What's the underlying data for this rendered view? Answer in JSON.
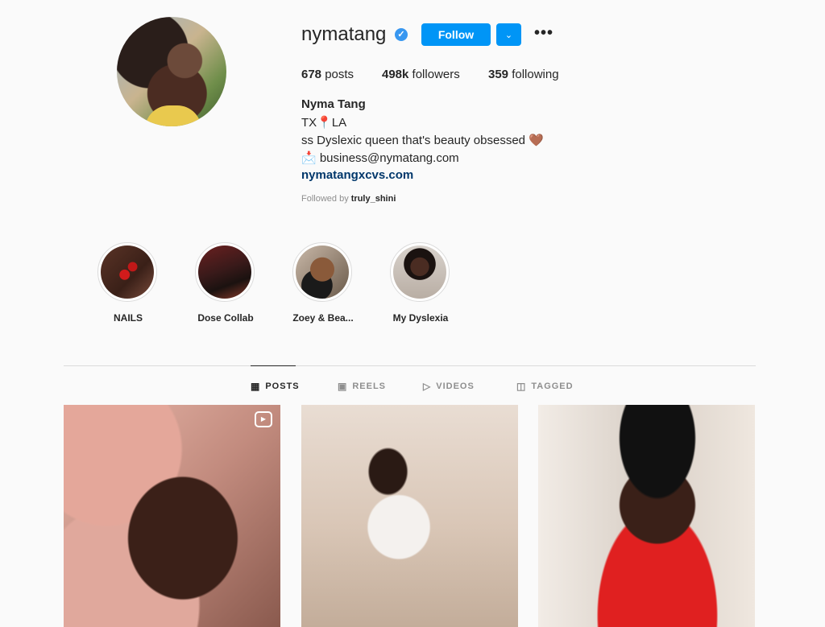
{
  "profile": {
    "username": "nymatang",
    "verified_icon": "verified-badge-icon",
    "follow_label": "Follow",
    "dropdown_icon": "chevron-down-icon",
    "more_icon": "more-options-icon",
    "posts_count": "678",
    "posts_label": "posts",
    "followers_count": "498k",
    "followers_label": "followers",
    "following_count": "359",
    "following_label": "following",
    "full_name": "Nyma Tang",
    "bio_line1": "TX📍LA",
    "bio_line2": "ss Dyslexic queen that's beauty obsessed 🤎",
    "bio_line3": "📩 business@nymatang.com",
    "website": "nymatangxcvs.com",
    "followed_by_prefix": "Followed by",
    "followed_by_user": "truly_shini"
  },
  "highlights": [
    {
      "label": "NAILS"
    },
    {
      "label": "Dose Collab"
    },
    {
      "label": "Zoey & Bea..."
    },
    {
      "label": "My Dyslexia"
    }
  ],
  "tabs": [
    {
      "label": "POSTS",
      "icon": "grid-icon",
      "active": true
    },
    {
      "label": "REELS",
      "icon": "reels-icon",
      "active": false
    },
    {
      "label": "VIDEOS",
      "icon": "video-play-icon",
      "active": false
    },
    {
      "label": "TAGGED",
      "icon": "tagged-icon",
      "active": false
    }
  ],
  "colors": {
    "accent": "#0095f6",
    "background": "#fafafa",
    "link": "#00376b"
  }
}
